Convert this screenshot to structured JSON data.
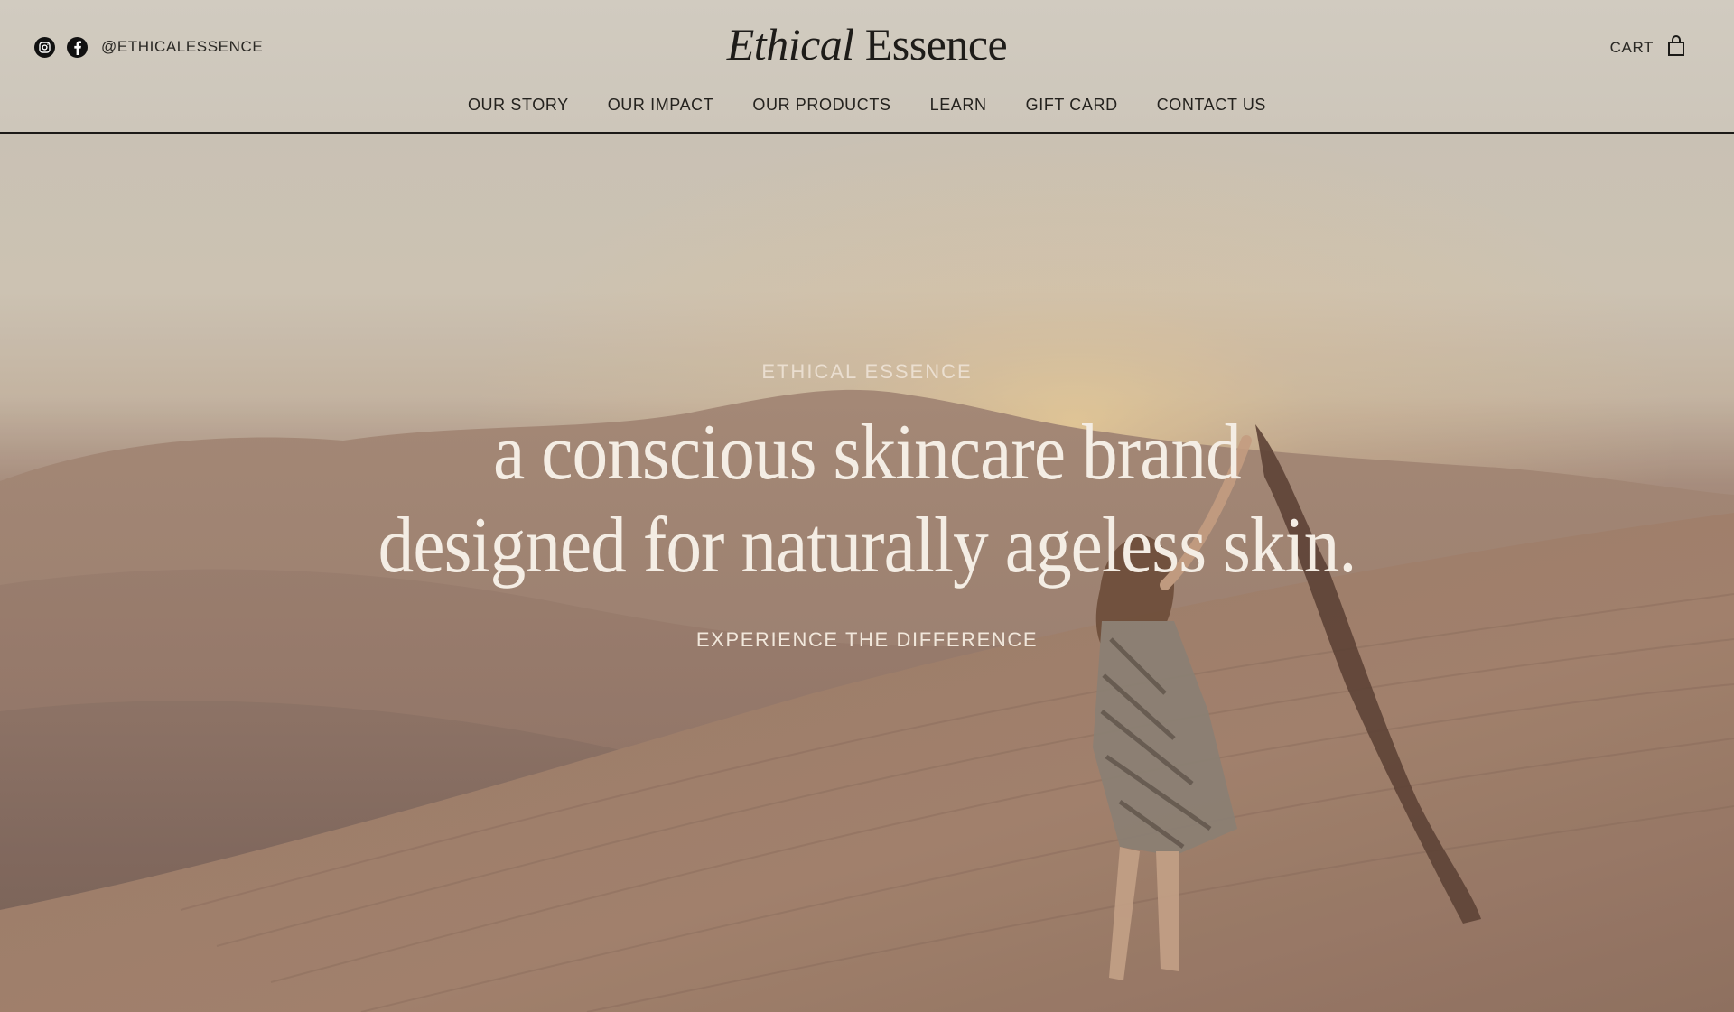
{
  "header": {
    "social": {
      "icons": [
        "instagram-icon",
        "facebook-icon"
      ],
      "handle": "@ETHICALESSENCE"
    },
    "logo": {
      "italic": "Ethical",
      "regular": "Essence"
    },
    "cart": {
      "label": "CART",
      "icon": "shopping-bag-icon"
    },
    "nav": [
      {
        "label": "OUR STORY"
      },
      {
        "label": "OUR IMPACT"
      },
      {
        "label": "OUR PRODUCTS"
      },
      {
        "label": "LEARN"
      },
      {
        "label": "GIFT CARD"
      },
      {
        "label": "CONTACT US"
      }
    ]
  },
  "hero": {
    "eyebrow": "ETHICAL ESSENCE",
    "title_lines": [
      "a conscious skincare brand",
      "designed for naturally ageless skin."
    ],
    "cta": "EXPERIENCE THE DIFFERENCE",
    "image_description": "woman in striped dress holding a scarf in the wind on desert sand dunes at sunset"
  },
  "colors": {
    "header_bg": "#cfc8bc",
    "text_dark": "#1e1c19",
    "hero_text": "#f4ede4",
    "divider": "#1c1a17"
  }
}
